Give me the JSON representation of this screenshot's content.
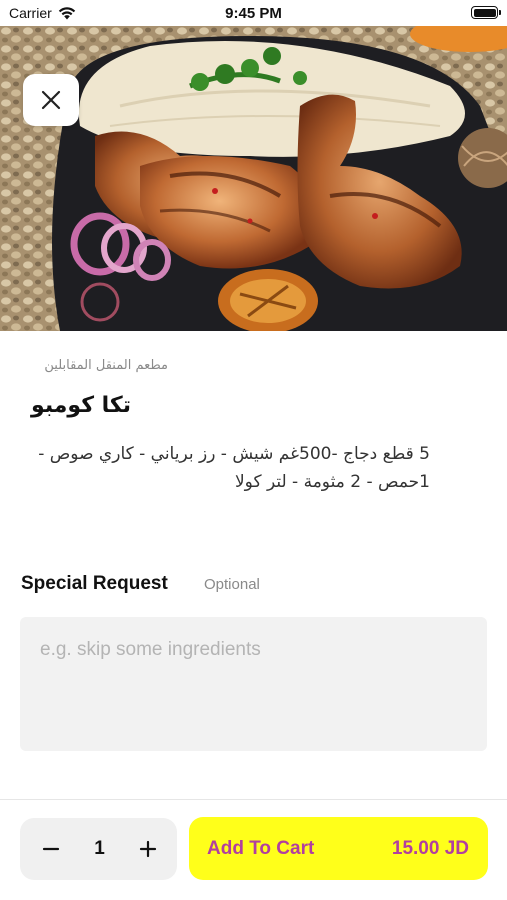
{
  "status_bar": {
    "carrier": "Carrier",
    "time": "9:45 PM"
  },
  "icons": {
    "close": "close-icon",
    "wifi": "wifi-icon",
    "battery": "battery-icon",
    "minus": "minus-icon",
    "plus": "plus-icon"
  },
  "item": {
    "restaurant": "مطعم المنقل المقابلين",
    "title": "تكا كومبو",
    "description": "5 قطع دجاج -500غم شيش - رز برياني - كاري صوص - 1حمص - 2 مثومة - لتر كولا"
  },
  "special_request": {
    "label": "Special Request",
    "optional": "Optional",
    "placeholder": "e.g. skip some ingredients",
    "value": ""
  },
  "cart": {
    "quantity": "1",
    "add_label": "Add To Cart",
    "price": "15.00 JD"
  },
  "colors": {
    "accent": "#ffff1a",
    "accent_text": "#b13fa0",
    "placeholder": "#b4b4b4"
  }
}
